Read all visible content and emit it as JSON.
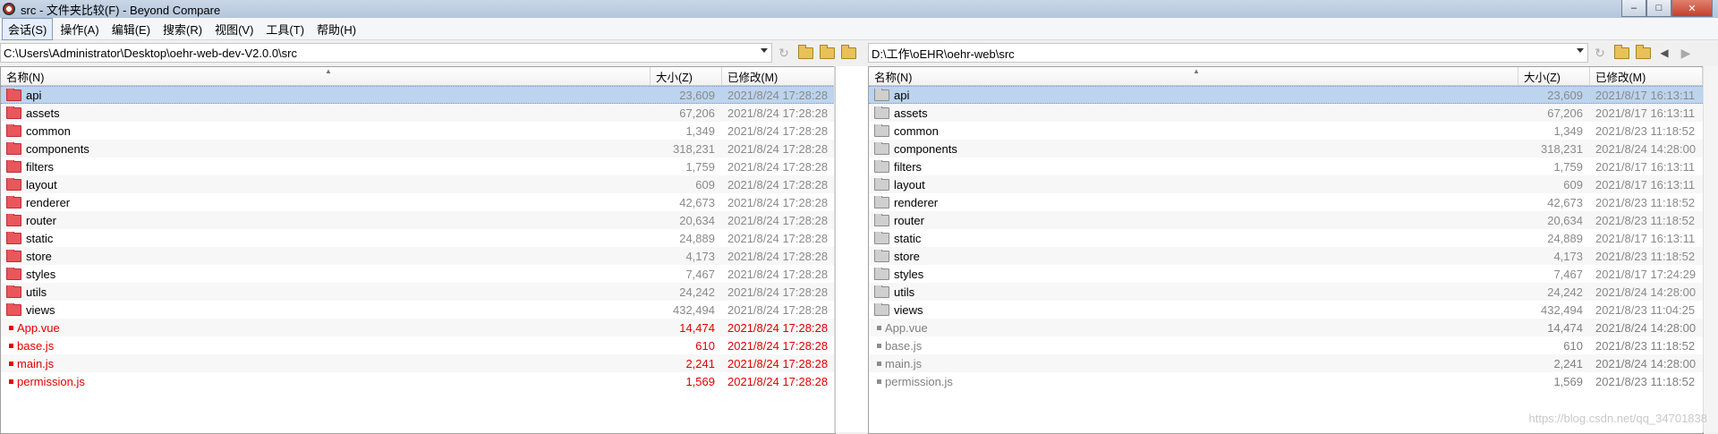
{
  "window": {
    "title": "src - 文件夹比较(F) - Beyond Compare"
  },
  "menu": [
    "会话(S)",
    "操作(A)",
    "编辑(E)",
    "搜索(R)",
    "视图(V)",
    "工具(T)",
    "帮助(H)"
  ],
  "left": {
    "path": "C:\\Users\\Administrator\\Desktop\\oehr-web-dev-V2.0.0\\src"
  },
  "right": {
    "path": "D:\\工作\\oEHR\\oehr-web\\src"
  },
  "columns": {
    "name": "名称(N)",
    "size": "大小(Z)",
    "modified": "已修改(M)"
  },
  "left_rows": [
    {
      "name": "api",
      "size": "23,609",
      "date": "2021/8/24 17:28:28",
      "type": "folder"
    },
    {
      "name": "assets",
      "size": "67,206",
      "date": "2021/8/24 17:28:28",
      "type": "folder"
    },
    {
      "name": "common",
      "size": "1,349",
      "date": "2021/8/24 17:28:28",
      "type": "folder"
    },
    {
      "name": "components",
      "size": "318,231",
      "date": "2021/8/24 17:28:28",
      "type": "folder"
    },
    {
      "name": "filters",
      "size": "1,759",
      "date": "2021/8/24 17:28:28",
      "type": "folder"
    },
    {
      "name": "layout",
      "size": "609",
      "date": "2021/8/24 17:28:28",
      "type": "folder"
    },
    {
      "name": "renderer",
      "size": "42,673",
      "date": "2021/8/24 17:28:28",
      "type": "folder"
    },
    {
      "name": "router",
      "size": "20,634",
      "date": "2021/8/24 17:28:28",
      "type": "folder"
    },
    {
      "name": "static",
      "size": "24,889",
      "date": "2021/8/24 17:28:28",
      "type": "folder"
    },
    {
      "name": "store",
      "size": "4,173",
      "date": "2021/8/24 17:28:28",
      "type": "folder"
    },
    {
      "name": "styles",
      "size": "7,467",
      "date": "2021/8/24 17:28:28",
      "type": "folder"
    },
    {
      "name": "utils",
      "size": "24,242",
      "date": "2021/8/24 17:28:28",
      "type": "folder"
    },
    {
      "name": "views",
      "size": "432,494",
      "date": "2021/8/24 17:28:28",
      "type": "folder"
    },
    {
      "name": "App.vue",
      "size": "14,474",
      "date": "2021/8/24 17:28:28",
      "type": "file"
    },
    {
      "name": "base.js",
      "size": "610",
      "date": "2021/8/24 17:28:28",
      "type": "file"
    },
    {
      "name": "main.js",
      "size": "2,241",
      "date": "2021/8/24 17:28:28",
      "type": "file"
    },
    {
      "name": "permission.js",
      "size": "1,569",
      "date": "2021/8/24 17:28:28",
      "type": "file"
    }
  ],
  "right_rows": [
    {
      "name": "api",
      "size": "23,609",
      "date": "2021/8/17 16:13:11",
      "type": "folder"
    },
    {
      "name": "assets",
      "size": "67,206",
      "date": "2021/8/17 16:13:11",
      "type": "folder"
    },
    {
      "name": "common",
      "size": "1,349",
      "date": "2021/8/23 11:18:52",
      "type": "folder"
    },
    {
      "name": "components",
      "size": "318,231",
      "date": "2021/8/24 14:28:00",
      "type": "folder"
    },
    {
      "name": "filters",
      "size": "1,759",
      "date": "2021/8/17 16:13:11",
      "type": "folder"
    },
    {
      "name": "layout",
      "size": "609",
      "date": "2021/8/17 16:13:11",
      "type": "folder"
    },
    {
      "name": "renderer",
      "size": "42,673",
      "date": "2021/8/23 11:18:52",
      "type": "folder"
    },
    {
      "name": "router",
      "size": "20,634",
      "date": "2021/8/23 11:18:52",
      "type": "folder"
    },
    {
      "name": "static",
      "size": "24,889",
      "date": "2021/8/17 16:13:11",
      "type": "folder"
    },
    {
      "name": "store",
      "size": "4,173",
      "date": "2021/8/23 11:18:52",
      "type": "folder"
    },
    {
      "name": "styles",
      "size": "7,467",
      "date": "2021/8/17 17:24:29",
      "type": "folder"
    },
    {
      "name": "utils",
      "size": "24,242",
      "date": "2021/8/24 14:28:00",
      "type": "folder"
    },
    {
      "name": "views",
      "size": "432,494",
      "date": "2021/8/23 11:04:25",
      "type": "folder"
    },
    {
      "name": "App.vue",
      "size": "14,474",
      "date": "2021/8/24 14:28:00",
      "type": "file"
    },
    {
      "name": "base.js",
      "size": "610",
      "date": "2021/8/23 11:18:52",
      "type": "file"
    },
    {
      "name": "main.js",
      "size": "2,241",
      "date": "2021/8/24 14:28:00",
      "type": "file"
    },
    {
      "name": "permission.js",
      "size": "1,569",
      "date": "2021/8/23 11:18:52",
      "type": "file"
    }
  ],
  "watermark": "https://blog.csdn.net/qq_34701838",
  "colors": {
    "diff": "#e30000",
    "selected": "#bcd4ee",
    "folder_left": "#e9565c",
    "folder_right": "#cfcfcf"
  }
}
